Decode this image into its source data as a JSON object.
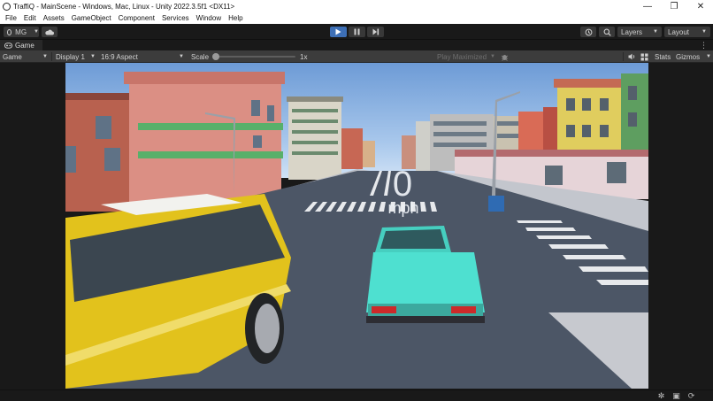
{
  "window": {
    "title": "TraffiQ - MainScene - Windows, Mac, Linux - Unity 2022.3.5f1 <DX11>"
  },
  "menu": {
    "items": [
      "File",
      "Edit",
      "Assets",
      "GameObject",
      "Component",
      "Services",
      "Window",
      "Help"
    ]
  },
  "toolbar": {
    "account_label": "MG",
    "layers_label": "Layers",
    "layout_label": "Layout"
  },
  "tab": {
    "label": "Game"
  },
  "game_bar": {
    "view_label": "Game",
    "display_label": "Display 1",
    "aspect_label": "16:9 Aspect",
    "scale_label": "Scale",
    "scale_value": "1x",
    "play_mode_label": "Play Maximized",
    "stats_label": "Stats",
    "gizmos_label": "Gizmos"
  },
  "scene": {
    "speed_value": "0",
    "speed_unit": "mph"
  },
  "colors": {
    "editor_bg": "#191919",
    "toolbar_button": "#383838",
    "gamebar_bg": "#3c3c3c",
    "play_active": "#3d6fb6",
    "sky": "#8fb5e0",
    "road": "#4c5666",
    "yellow_car": "#e2c21c",
    "teal_car": "#4ee0d0"
  },
  "icons": [
    "unity-logo-icon",
    "minimize-icon",
    "maximize-icon",
    "close-icon",
    "account-icon",
    "cloud-icon",
    "play-icon",
    "pause-icon",
    "step-icon",
    "history-icon",
    "search-icon",
    "game-tab-icon",
    "more-icon",
    "mute-icon",
    "gizmo-bug-icon",
    "gizmos-grid-icon",
    "statusbar-bug-icon",
    "statusbar-network-icon",
    "statusbar-sync-icon"
  ]
}
